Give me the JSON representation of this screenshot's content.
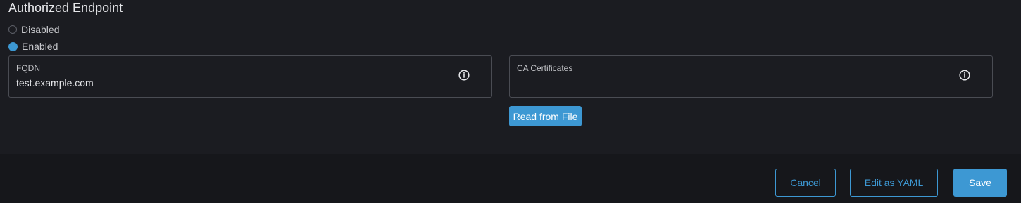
{
  "section": {
    "title": "Authorized Endpoint"
  },
  "radio_options": [
    {
      "label": "Disabled",
      "checked": false
    },
    {
      "label": "Enabled",
      "checked": true
    }
  ],
  "fqdn": {
    "label": "FQDN",
    "value": "test.example.com"
  },
  "ca_certificates": {
    "label": "CA Certificates",
    "value": ""
  },
  "read_from_file_label": "Read from File",
  "footer": {
    "cancel_label": "Cancel",
    "edit_yaml_label": "Edit as YAML",
    "save_label": "Save"
  },
  "colors": {
    "accent": "#3d98d3",
    "background": "#1b1c21",
    "footer_background": "#16171b"
  },
  "icons": {
    "info": "info-circle-icon"
  }
}
